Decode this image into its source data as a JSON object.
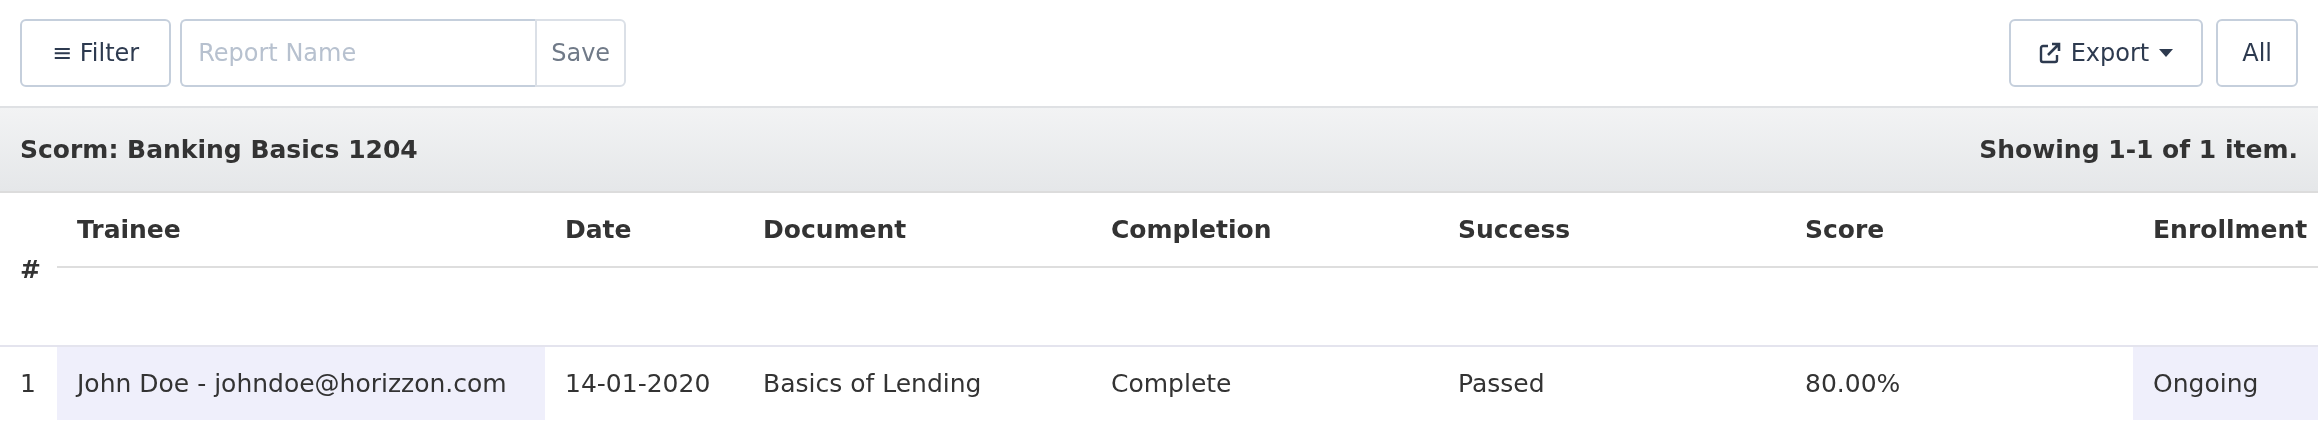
{
  "toolbar": {
    "filter_button": "≡ Filter",
    "report_name": {
      "placeholder": "Report Name"
    },
    "save_button": "Save",
    "export_button": "Export",
    "all_button": "All"
  },
  "header": {
    "title": "Scorm: Banking Basics 1204",
    "summary": "Showing 1-1 of 1 item."
  },
  "table": {
    "index_column": "#",
    "columns": [
      {
        "label": "Trainee",
        "highlighted": true
      },
      {
        "label": "Date",
        "highlighted": false
      },
      {
        "label": "Document",
        "highlighted": false
      },
      {
        "label": "Completion",
        "highlighted": false
      },
      {
        "label": "Success",
        "highlighted": false
      },
      {
        "label": "Score",
        "highlighted": false
      },
      {
        "label": "Enrollment",
        "highlighted": true
      }
    ],
    "rows": [
      {
        "index": "1",
        "cells": [
          "John Doe - johndoe@horizzon.com",
          "14-01-2020",
          "Basics of Lending",
          "Complete",
          "Passed",
          "80.00%",
          "Ongoing"
        ]
      }
    ]
  }
}
